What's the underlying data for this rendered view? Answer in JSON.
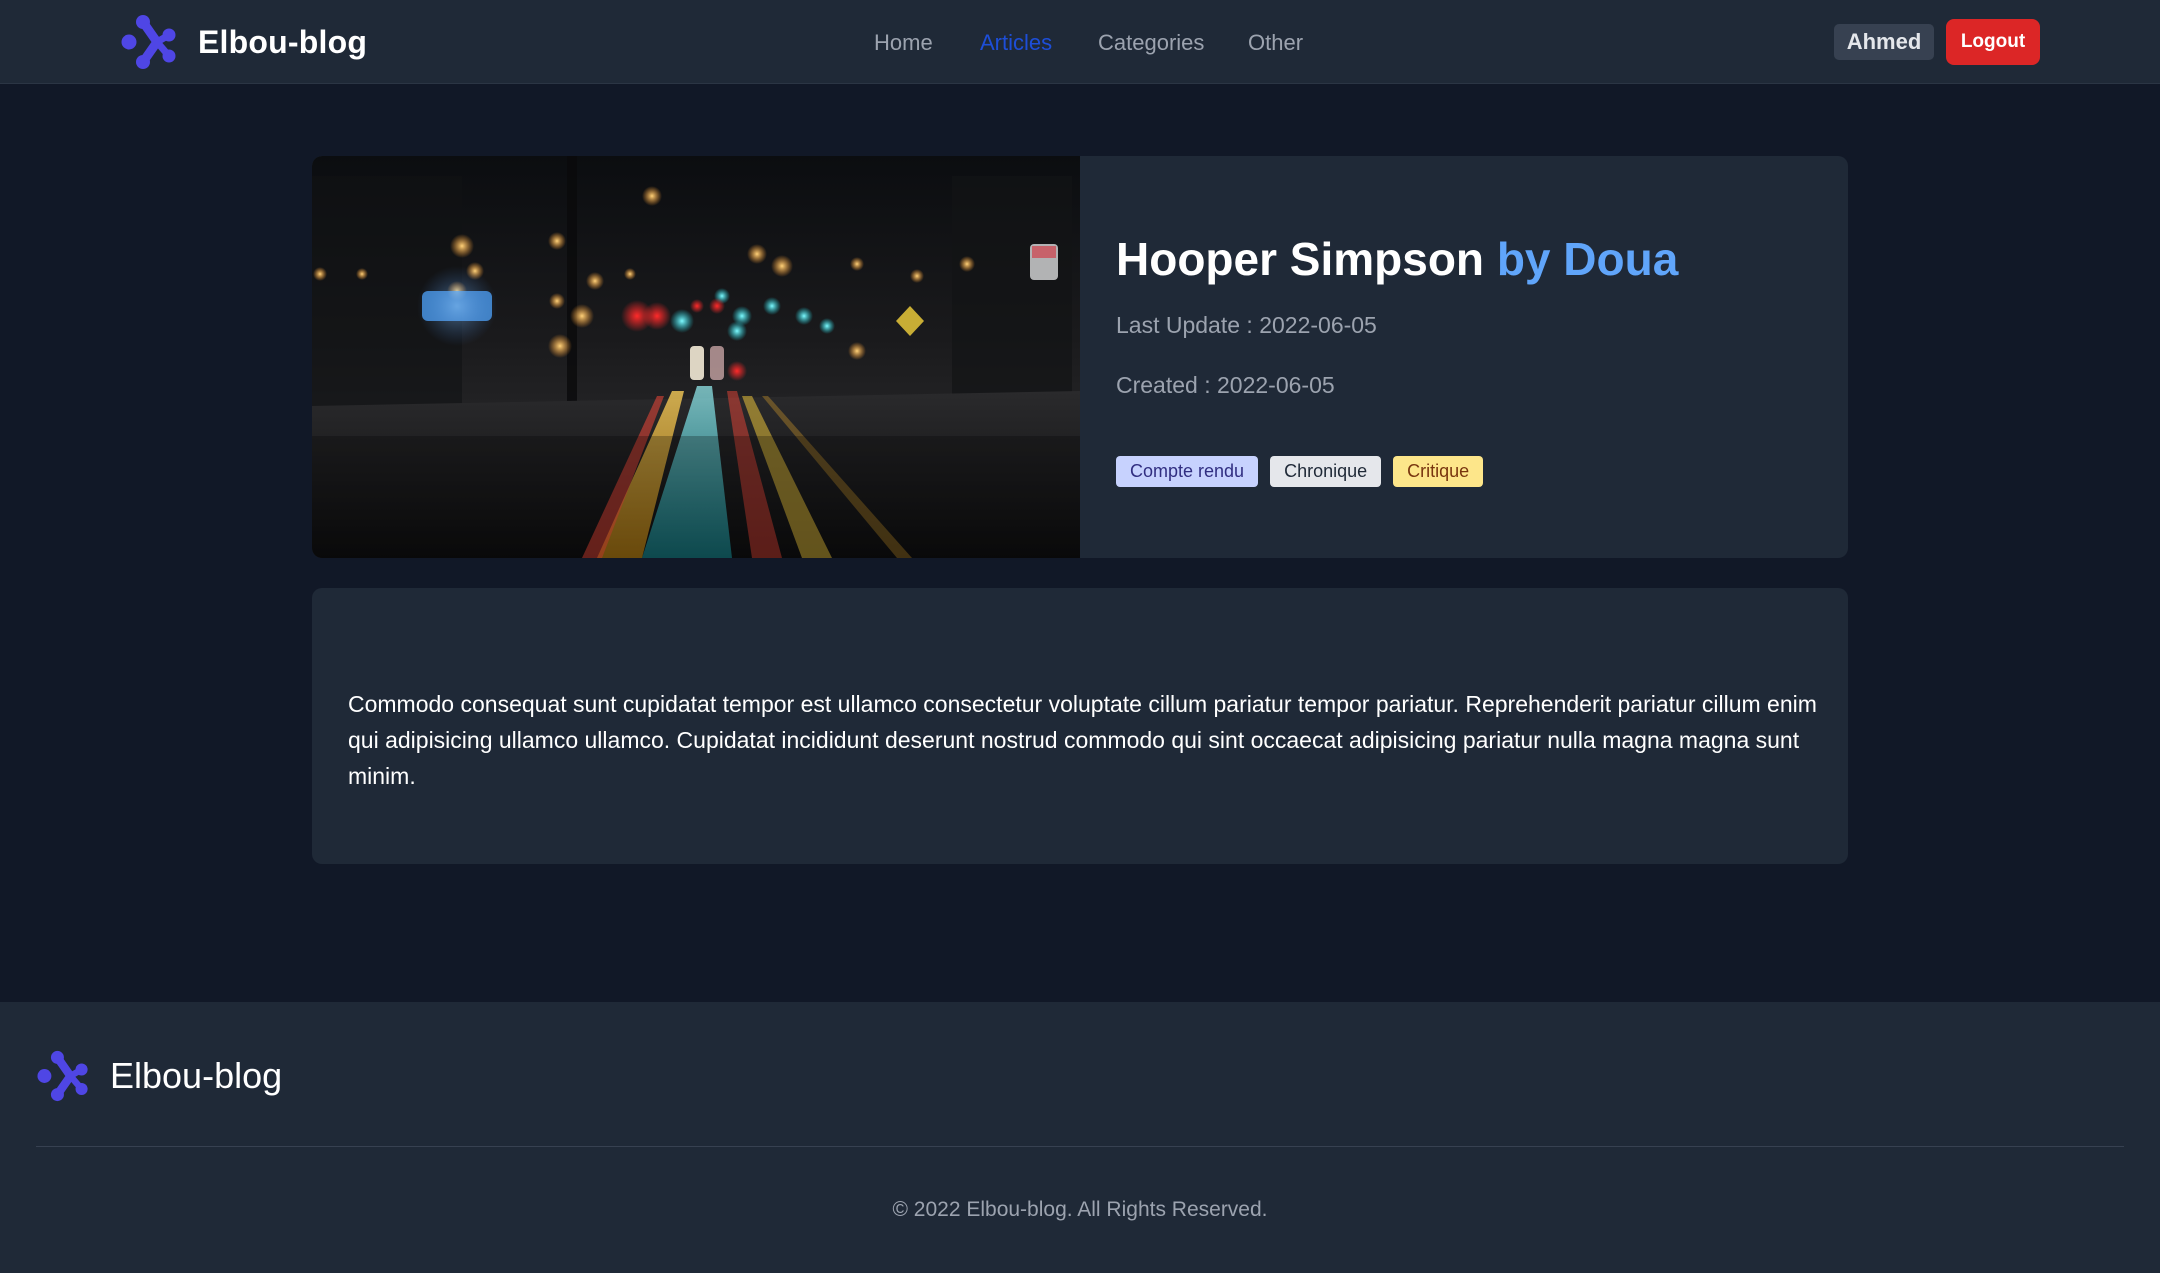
{
  "header": {
    "brand": "Elbou-blog",
    "nav": [
      {
        "label": "Home"
      },
      {
        "label": "Articles",
        "active": true
      },
      {
        "label": "Categories"
      },
      {
        "label": "Other"
      }
    ],
    "user": "Ahmed",
    "logout_label": "Logout"
  },
  "article": {
    "title": "Hooper Simpson",
    "author_prefix": "by Doua",
    "last_update": "Last Update : 2022-06-05",
    "created": "Created : 2022-06-05",
    "tags": [
      "Compte rendu",
      "Chronique",
      "Critique"
    ],
    "body": "Commodo consequat sunt cupidatat tempor est ullamco consectetur voluptate cillum pariatur tempor pariatur. Reprehenderit pariatur cillum enim qui adipisicing ullamco ullamco. Cupidatat incididunt deserunt nostrud commodo qui sint occaecat adipisicing pariatur nulla magna magna sunt minim."
  },
  "footer": {
    "brand": "Elbou-blog",
    "copyright": "© 2022 Elbou-blog. All Rights Reserved."
  },
  "colors": {
    "page_bg": "#111827",
    "card_bg": "#1f2937",
    "accent_blue": "#60a5fa",
    "nav_active": "#1d4ed8",
    "logout_red": "#dc2626",
    "logo_indigo": "#4f46e5"
  },
  "icons": {
    "logo": "brand-logo-icon",
    "hero": "night-street-photo"
  }
}
